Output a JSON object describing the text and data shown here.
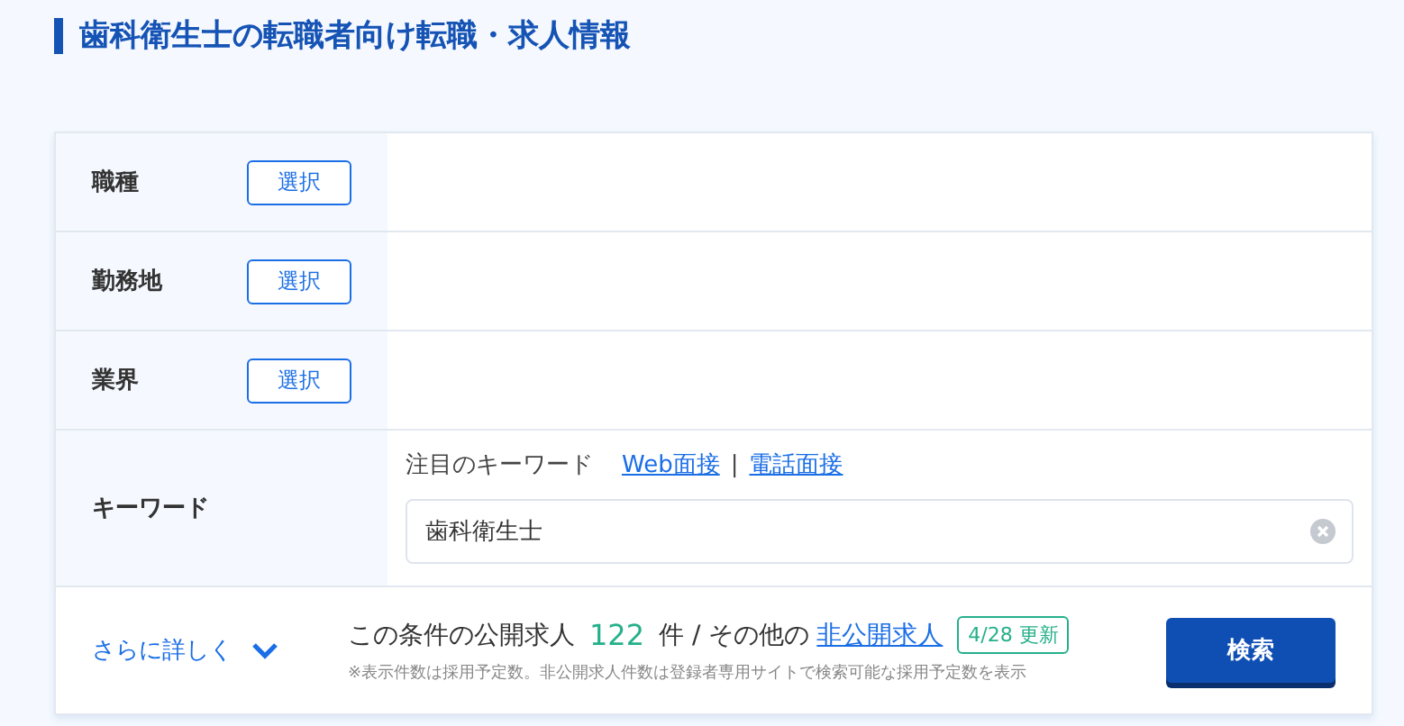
{
  "title": "歯科衛生士の転職者向け転職・求人情報",
  "filters": [
    {
      "label": "職種",
      "button": "選択"
    },
    {
      "label": "勤務地",
      "button": "選択"
    },
    {
      "label": "業界",
      "button": "選択"
    }
  ],
  "keyword": {
    "label": "キーワード",
    "hint": "注目のキーワード",
    "links": [
      "Web面接",
      "電話面接"
    ],
    "separator": "|",
    "value": "歯科衛生士"
  },
  "footer": {
    "more": "さらに詳しく",
    "result_prefix": "この条件の公開求人",
    "count": "122",
    "result_middle": "件 / その他の",
    "private_link": "非公開求人",
    "updated": "4/28 更新",
    "note": "※表示件数は採用予定数。非公開求人件数は登録者専用サイトで検索可能な採用予定数を表示",
    "search_button": "検索"
  }
}
